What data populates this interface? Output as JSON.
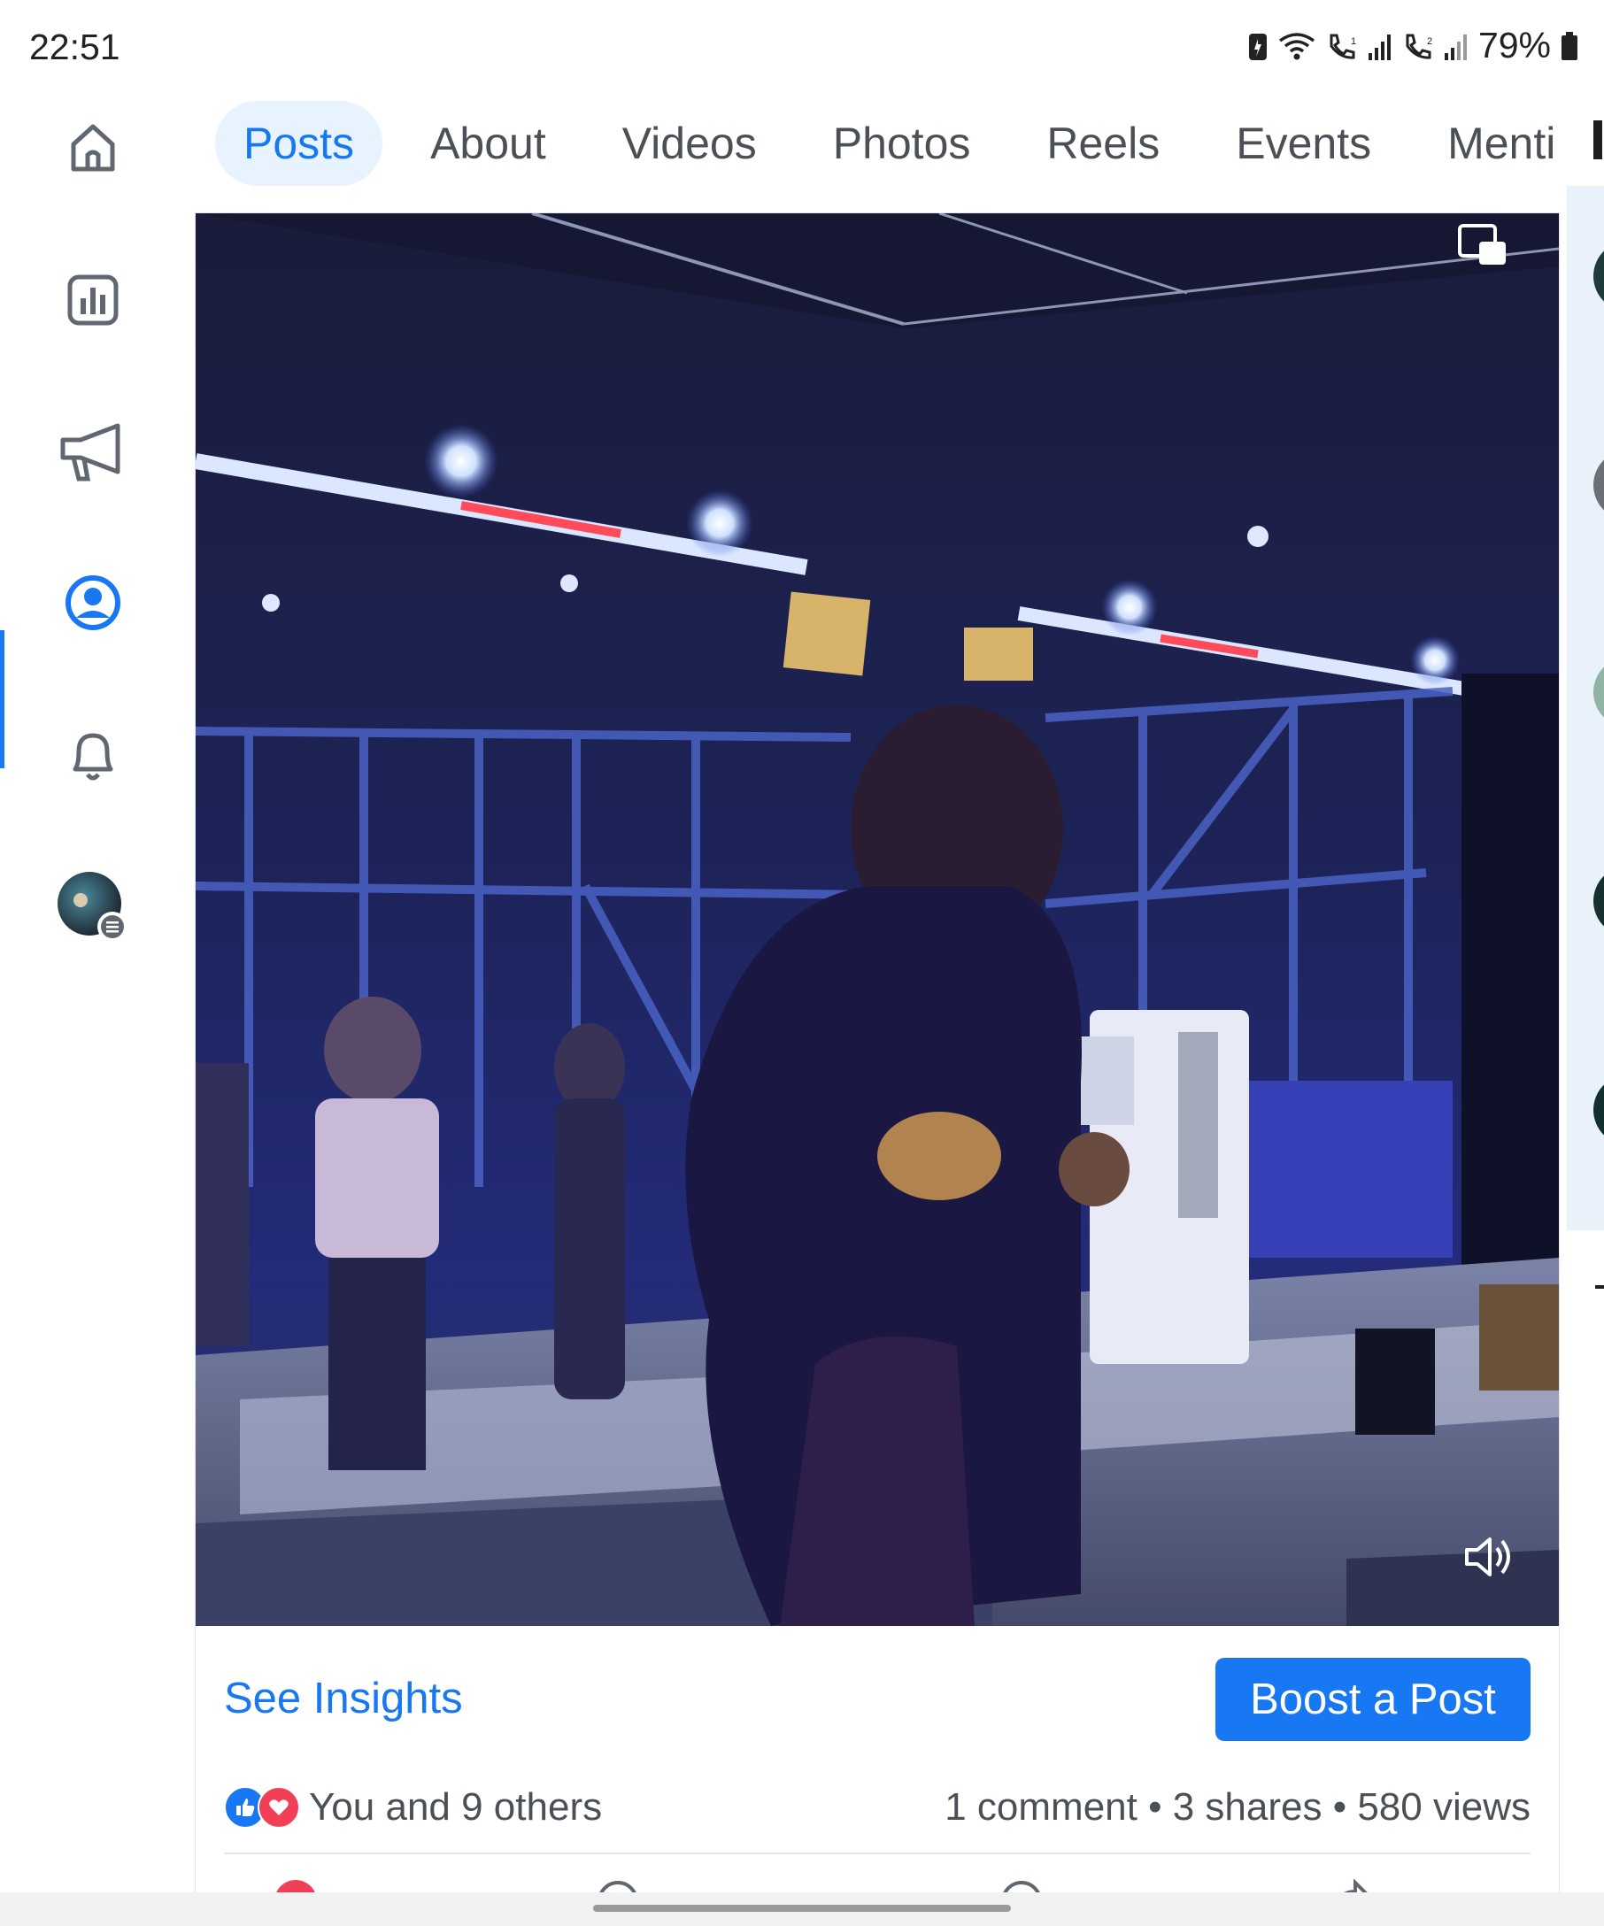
{
  "status_bar": {
    "time": "22:51",
    "battery": "79%",
    "icons": [
      "wifi-icon",
      "call-sim1-icon",
      "signal-icon",
      "call-sim2-icon",
      "signal-icon",
      "battery-icon"
    ]
  },
  "left_nav": {
    "items": [
      {
        "name": "home-icon",
        "active": false
      },
      {
        "name": "insights-icon",
        "active": false
      },
      {
        "name": "megaphone-icon",
        "active": false
      },
      {
        "name": "profile-icon",
        "active": true
      },
      {
        "name": "bell-icon",
        "active": false
      },
      {
        "name": "account-avatar",
        "active": false
      }
    ]
  },
  "tabs": [
    {
      "label": "Posts",
      "active": true
    },
    {
      "label": "About",
      "active": false
    },
    {
      "label": "Videos",
      "active": false
    },
    {
      "label": "Photos",
      "active": false
    },
    {
      "label": "Reels",
      "active": false
    },
    {
      "label": "Events",
      "active": false
    },
    {
      "label": "Menti",
      "active": false
    }
  ],
  "post": {
    "video_icons": [
      "picture-in-picture-icon",
      "volume-icon"
    ],
    "insights_label": "See Insights",
    "boost_label": "Boost a Post",
    "reactions_text": "You and 9 others",
    "stats": "1 comment • 3 shares • 580 views"
  },
  "colors": {
    "accent": "#1877f2",
    "tab_active_bg": "#e7f3ff",
    "like": "#1877f2",
    "love": "#f33e58"
  }
}
